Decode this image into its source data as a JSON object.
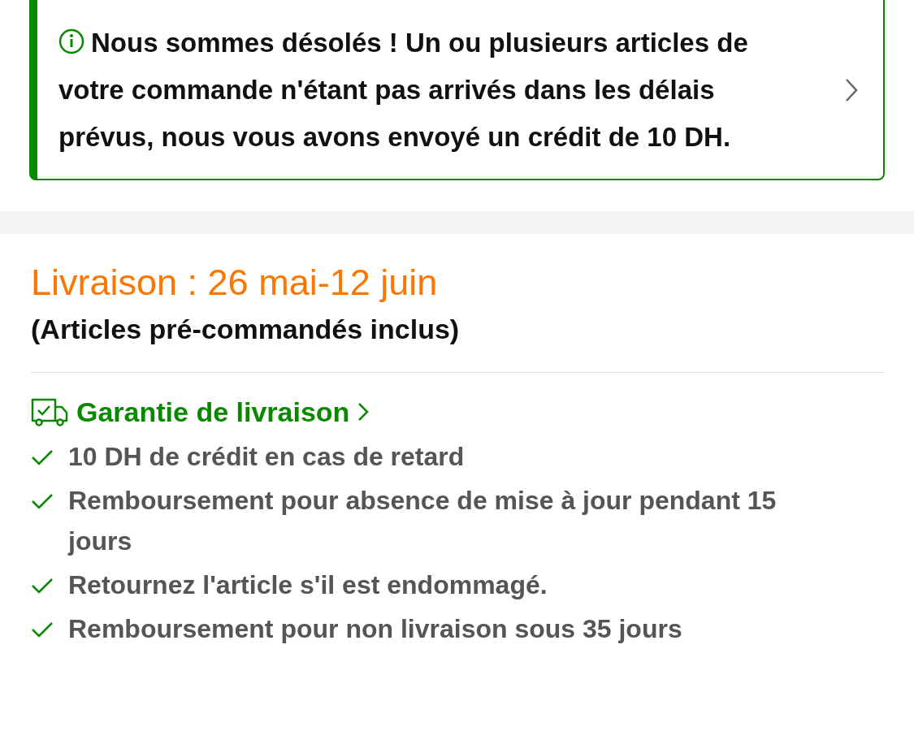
{
  "notice": {
    "text": "Nous sommes désolés ! Un ou plusieurs articles de votre commande n'étant pas arrivés dans les délais prévus, nous vous avons envoyé un crédit de 10 DH."
  },
  "delivery": {
    "title": "Livraison : 26 mai-12 juin",
    "subtitle": "(Articles pré-commandés inclus)"
  },
  "guarantee": {
    "title": "Garantie de livraison",
    "items": [
      "10 DH de crédit en cas de retard",
      "Remboursement pour absence de mise à jour pendant 15 jours",
      "Retournez l'article s'il est endommagé.",
      "Remboursement pour non livraison sous 35 jours"
    ]
  }
}
